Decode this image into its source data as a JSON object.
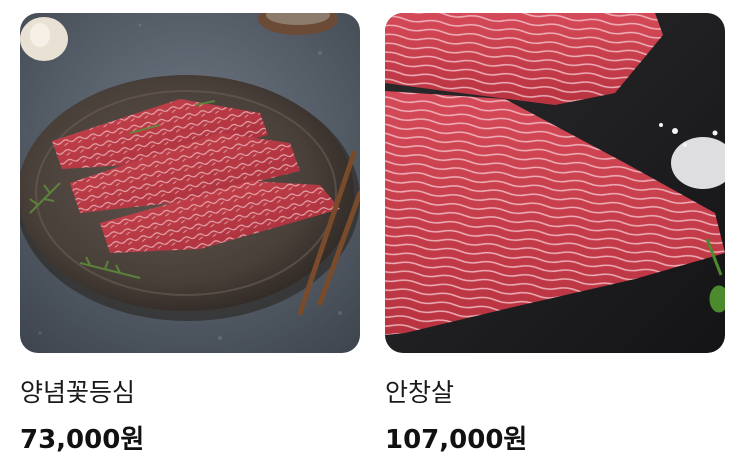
{
  "products": [
    {
      "image": "marinated-sirloin-steaks-on-plate-photo",
      "name": "양념꽃등심",
      "price": "73,000원"
    },
    {
      "image": "raw-skirt-steak-photo",
      "name": "안창살",
      "price": "107,000원"
    }
  ],
  "colors": {
    "text": "#1a1a1a",
    "price": "#111111",
    "background": "#ffffff"
  }
}
